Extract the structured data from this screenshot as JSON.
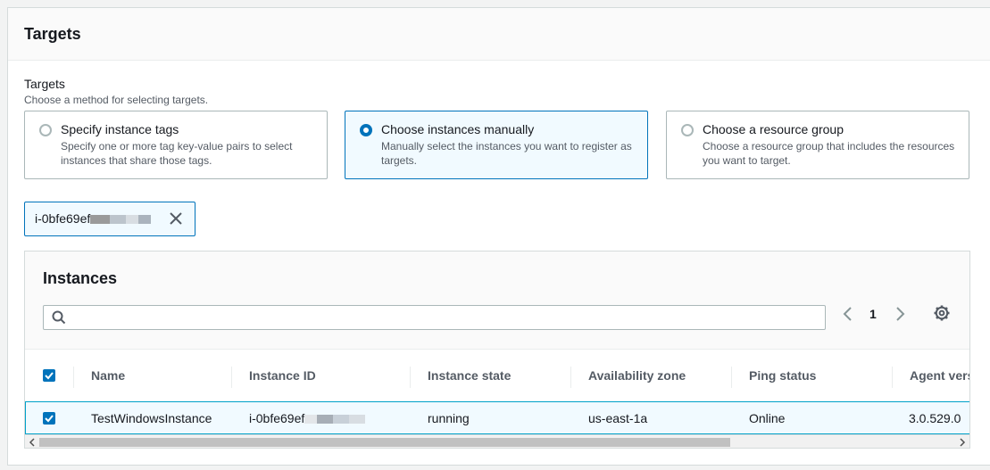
{
  "section": {
    "title": "Targets"
  },
  "targets_field": {
    "label": "Targets",
    "description": "Choose a method for selecting targets.",
    "options": [
      {
        "title": "Specify instance tags",
        "description": "Specify one or more tag key-value pairs to select instances that share those tags.",
        "selected": false
      },
      {
        "title": "Choose instances manually",
        "description": "Manually select the instances you want to register as targets.",
        "selected": true
      },
      {
        "title": "Choose a resource group",
        "description": "Choose a resource group that includes the resources you want to target.",
        "selected": false
      }
    ]
  },
  "token": {
    "label": "i-0bfe69ef"
  },
  "instances": {
    "title": "Instances",
    "search_placeholder": "",
    "page": "1",
    "columns": [
      "Name",
      "Instance ID",
      "Instance state",
      "Availability zone",
      "Ping status",
      "Agent vers"
    ],
    "rows": [
      {
        "name": "TestWindowsInstance",
        "instance_id": "i-0bfe69ef",
        "state": "running",
        "az": "us-east-1a",
        "ping": "Online",
        "agent": "3.0.529.0",
        "selected": true
      }
    ]
  },
  "colors": {
    "accent": "#0073bb",
    "selected_bg": "#f1faff",
    "row_border": "#00a1c9"
  },
  "icons": [
    "search-icon",
    "close-icon",
    "chevron-left-icon",
    "chevron-right-icon",
    "gear-icon",
    "checkmark-icon"
  ]
}
